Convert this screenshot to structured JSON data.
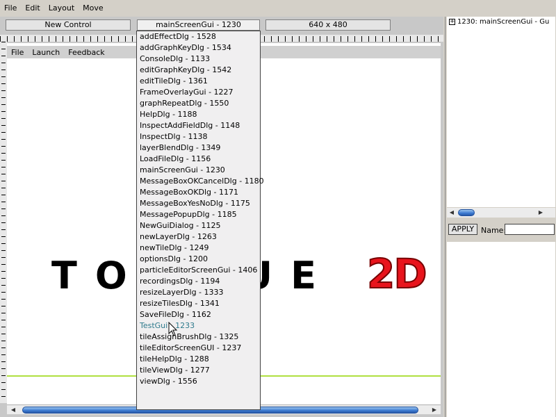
{
  "menubar": [
    "File",
    "Edit",
    "Layout",
    "Move"
  ],
  "toolbar": {
    "new_control": "New Control",
    "gui_select": "mainScreenGui - 1230",
    "resolution": "640 x 480"
  },
  "canvas": {
    "menu": [
      "File",
      "Launch",
      "Feedback"
    ],
    "logo_text": "TORQUE",
    "logo_2d": "2D"
  },
  "dropdown": {
    "hover_index": 26,
    "items": [
      "addEffectDlg - 1528",
      "addGraphKeyDlg - 1534",
      "ConsoleDlg - 1133",
      "editGraphKeyDlg - 1542",
      "editTileDlg - 1361",
      "FrameOverlayGui - 1227",
      "graphRepeatDlg - 1550",
      "HelpDlg - 1188",
      "InspectAddFieldDlg - 1148",
      "InspectDlg - 1138",
      "layerBlendDlg - 1349",
      "LoadFileDlg - 1156",
      "mainScreenGui - 1230",
      "MessageBoxOKCancelDlg - 1180",
      "MessageBoxOKDlg - 1171",
      "MessageBoxYesNoDlg - 1175",
      "MessagePopupDlg - 1185",
      "NewGuiDialog - 1125",
      "newLayerDlg - 1263",
      "newTileDlg - 1249",
      "optionsDlg - 1200",
      "particleEditorScreenGui - 1406",
      "recordingsDlg - 1194",
      "resizeLayerDlg - 1333",
      "resizeTilesDlg - 1341",
      "SaveFileDlg - 1162",
      "TestGui - 1233",
      "tileAssignBrushDlg - 1325",
      "tileEditorScreenGUI - 1237",
      "tileHelpDlg - 1288",
      "tileViewDlg - 1277",
      "viewDlg - 1556"
    ]
  },
  "right_panel": {
    "tree_item": "1230: mainScreenGui - Gu",
    "tree_expander": "⊞",
    "apply_label": "APPLY",
    "name_label": "Name:",
    "name_value": ""
  },
  "colors": {
    "logo_2d": "#e8141c",
    "hover_text": "#2e7a8c",
    "scroll_thumb": "#3a78d0",
    "guide_line": "#b0e040"
  },
  "icons": {
    "scroll_left": "arrow-left-icon",
    "scroll_right": "arrow-right-icon",
    "tree_expand": "plus-box-icon",
    "cursor": "mouse-pointer-icon"
  }
}
